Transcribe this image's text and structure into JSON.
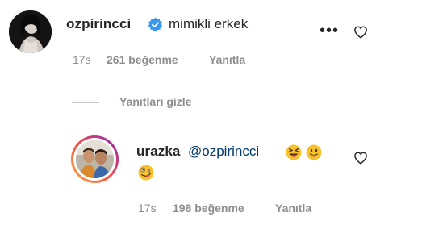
{
  "comment": {
    "username": "ozpirincci",
    "text": "mimikli erkek",
    "time": "17s",
    "likes": "261 beğenme",
    "reply_label": "Yanıtla",
    "more_icon": "more-horizontal-icon",
    "like_icon": "heart-outline-icon",
    "verified_icon": "verified-badge-icon",
    "verified_color": "#3897f0"
  },
  "replies_toggle": {
    "label": "Yanıtları gizle"
  },
  "reply": {
    "username": "urazka",
    "mention": "@ozpirincci",
    "emojis": [
      "squinting-tongue-emoji",
      "tongue-out-emoji",
      "zany-face-emoji"
    ],
    "time": "17s",
    "likes": "198 beğenme",
    "reply_label": "Yanıtla",
    "like_icon": "heart-outline-icon",
    "mention_color": "#00376b"
  }
}
